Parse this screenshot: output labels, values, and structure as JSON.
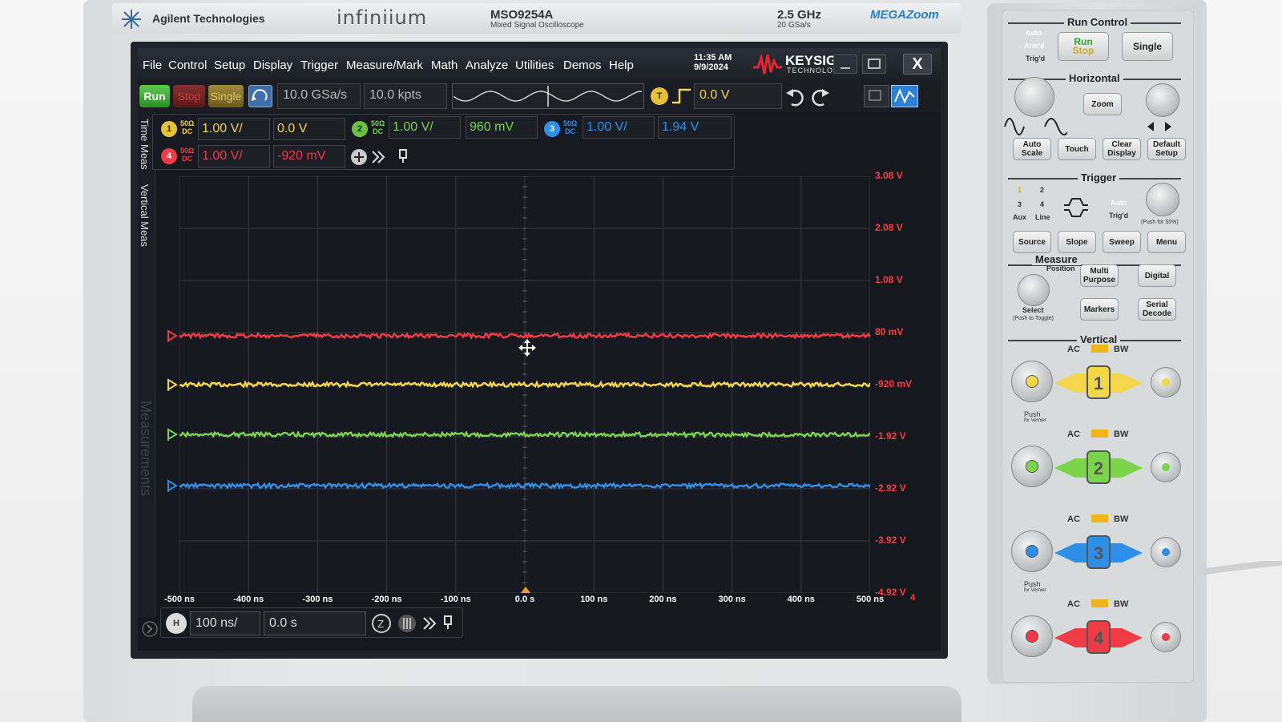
{
  "instrument": {
    "brand": "Agilent Technologies",
    "series": "infiniium",
    "model": "MSO9254A",
    "model_desc": "Mixed Signal Oscilloscope",
    "bandwidth": "2.5 GHz",
    "sample_rate_spec": "20 GSa/s",
    "megazoom": "MEGAZoom"
  },
  "menubar": {
    "items": [
      "File",
      "Control",
      "Setup",
      "Display",
      "Trigger",
      "Measure/Mark",
      "Math",
      "Analyze",
      "Utilities",
      "Demos",
      "Help"
    ],
    "time": "11:35 AM",
    "date": "9/9/2024",
    "vendor": "KEYSIGHT",
    "vendor_sub": "TECHNOLOGIES",
    "close": "X"
  },
  "toolbar": {
    "run": "Run",
    "stop": "Stop",
    "single": "Single",
    "sample_rate": "10.0 GSa/s",
    "memory_depth": "10.0 kpts",
    "trigger_badge": "T",
    "trigger_level": "0.0 V"
  },
  "channels": [
    {
      "num": "1",
      "imp": "50Ω",
      "coupling": "DC",
      "scale": "1.00 V/",
      "offset": "0.0 V",
      "color": "#f3d64a",
      "level_mv": -920
    },
    {
      "num": "2",
      "imp": "50Ω",
      "coupling": "DC",
      "scale": "1.00 V/",
      "offset": "960 mV",
      "color": "#7bd44c",
      "level_mv": -1880
    },
    {
      "num": "3",
      "imp": "50Ω",
      "coupling": "DC",
      "scale": "1.00 V/",
      "offset": "1.94 V",
      "color": "#2f8fe8",
      "level_mv": -2860
    },
    {
      "num": "4",
      "imp": "50Ω",
      "coupling": "DC",
      "scale": "1.00 V/",
      "offset": "-920 mV",
      "color": "#ee3b46",
      "level_mv": 20
    }
  ],
  "sidetabs": {
    "time_meas": "Time Meas",
    "vertical_meas": "Vertical Meas",
    "measurements": "Measurements"
  },
  "plot": {
    "y_ticks": [
      "3.08 V",
      "2.08 V",
      "1.08 V",
      "80 mV",
      "-920 mV",
      "-1.92 V",
      "-2.92 V",
      "-3.92 V",
      "-4.92 V"
    ],
    "x_ticks": [
      "-500 ns",
      "-400 ns",
      "-300 ns",
      "-200 ns",
      "-100 ns",
      "0.0 s",
      "100 ns",
      "200 ns",
      "300 ns",
      "400 ns",
      "500 ns"
    ],
    "ch4_tag": "4",
    "y_top_mv": 3080,
    "y_bottom_mv": -4920
  },
  "horizontal": {
    "badge": "H",
    "timebase": "100 ns/",
    "position": "0.0 s"
  },
  "panel": {
    "run_control": "Run Control",
    "auto_label": "Auto",
    "armd": "Arm'd",
    "trigd": "Trig'd",
    "run_stop_1": "Run",
    "run_stop_2": "Stop",
    "single": "Single",
    "horizontal": "Horizontal",
    "zoom": "Zoom",
    "auto_scale": "Auto Scale",
    "touch": "Touch",
    "clear_display": "Clear Display",
    "default_setup": "Default Setup",
    "trigger": "Trigger",
    "trig_nums": [
      "1",
      "2",
      "3",
      "4"
    ],
    "aux": "Aux",
    "line": "Line",
    "auto": "Auto",
    "trigd2": "Trig'd",
    "push_50": "(Push for 50%)",
    "source": "Source",
    "slope": "Slope",
    "sweep": "Sweep",
    "menu": "Menu",
    "measure": "Measure",
    "position": "Position",
    "multi_purpose": "Multi Purpose",
    "digital": "Digital",
    "select": "Select",
    "push_toggle": "(Push to Toggle)",
    "markers": "Markers",
    "serial_decode": "Serial Decode",
    "vertical": "Vertical",
    "ac": "AC",
    "fifty": "50Ω",
    "bw": "BW",
    "push": "Push",
    "for_vernier": "for Vernier",
    "ch_nums": [
      "1",
      "2",
      "3",
      "4"
    ]
  }
}
